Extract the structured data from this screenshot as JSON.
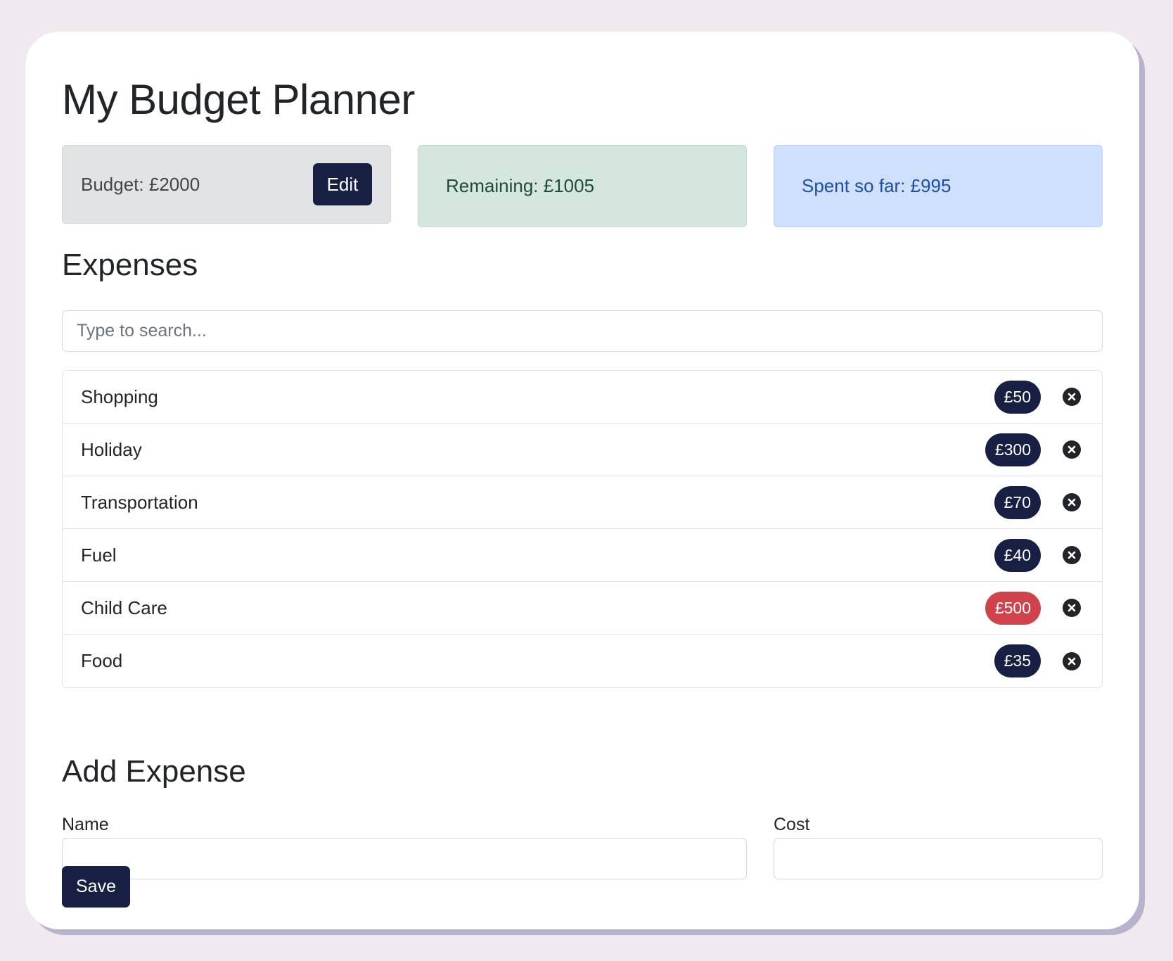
{
  "app": {
    "title": "My Budget Planner"
  },
  "budget": {
    "label": "Budget: £2000",
    "edit_label": "Edit"
  },
  "remaining": {
    "label": "Remaining: £1005"
  },
  "spent": {
    "label": "Spent so far: £995"
  },
  "expenses": {
    "heading": "Expenses",
    "search_placeholder": "Type to search...",
    "items": [
      {
        "name": "Shopping",
        "cost": "£50",
        "status": "normal"
      },
      {
        "name": "Holiday",
        "cost": "£300",
        "status": "normal"
      },
      {
        "name": "Transportation",
        "cost": "£70",
        "status": "normal"
      },
      {
        "name": "Fuel",
        "cost": "£40",
        "status": "normal"
      },
      {
        "name": "Child Care",
        "cost": "£500",
        "status": "danger"
      },
      {
        "name": "Food",
        "cost": "£35",
        "status": "normal"
      }
    ]
  },
  "add_expense": {
    "heading": "Add Expense",
    "name_label": "Name",
    "name_value": "",
    "cost_label": "Cost",
    "cost_value": "",
    "save_label": "Save"
  },
  "colors": {
    "accent": "#171f43",
    "danger": "#d0434c",
    "background": "#f1e9f0"
  },
  "icons": {
    "delete": "close-circle-icon"
  }
}
